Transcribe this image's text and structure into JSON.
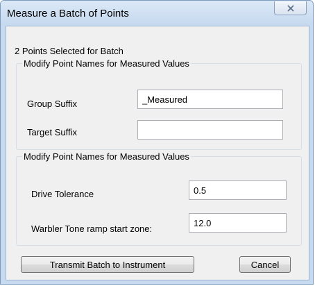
{
  "window": {
    "title": "Measure a Batch of Points",
    "close_icon": "close-x-icon"
  },
  "dialog": {
    "selected_count_text": "2 Points Selected for Batch",
    "group1": {
      "legend": "Modify Point Names for Measured Values",
      "group_suffix_label": "Group Suffix",
      "group_suffix_value": "_Measured",
      "target_suffix_label": "Target Suffix",
      "target_suffix_value": ""
    },
    "group2": {
      "legend": "Modify Point Names for Measured Values",
      "drive_tolerance_label": "Drive Tolerance",
      "drive_tolerance_value": "0.5",
      "warbler_label": "Warbler Tone ramp start zone:",
      "warbler_value": "12.0"
    },
    "buttons": {
      "transmit": "Transmit Batch to Instrument",
      "cancel": "Cancel"
    }
  }
}
